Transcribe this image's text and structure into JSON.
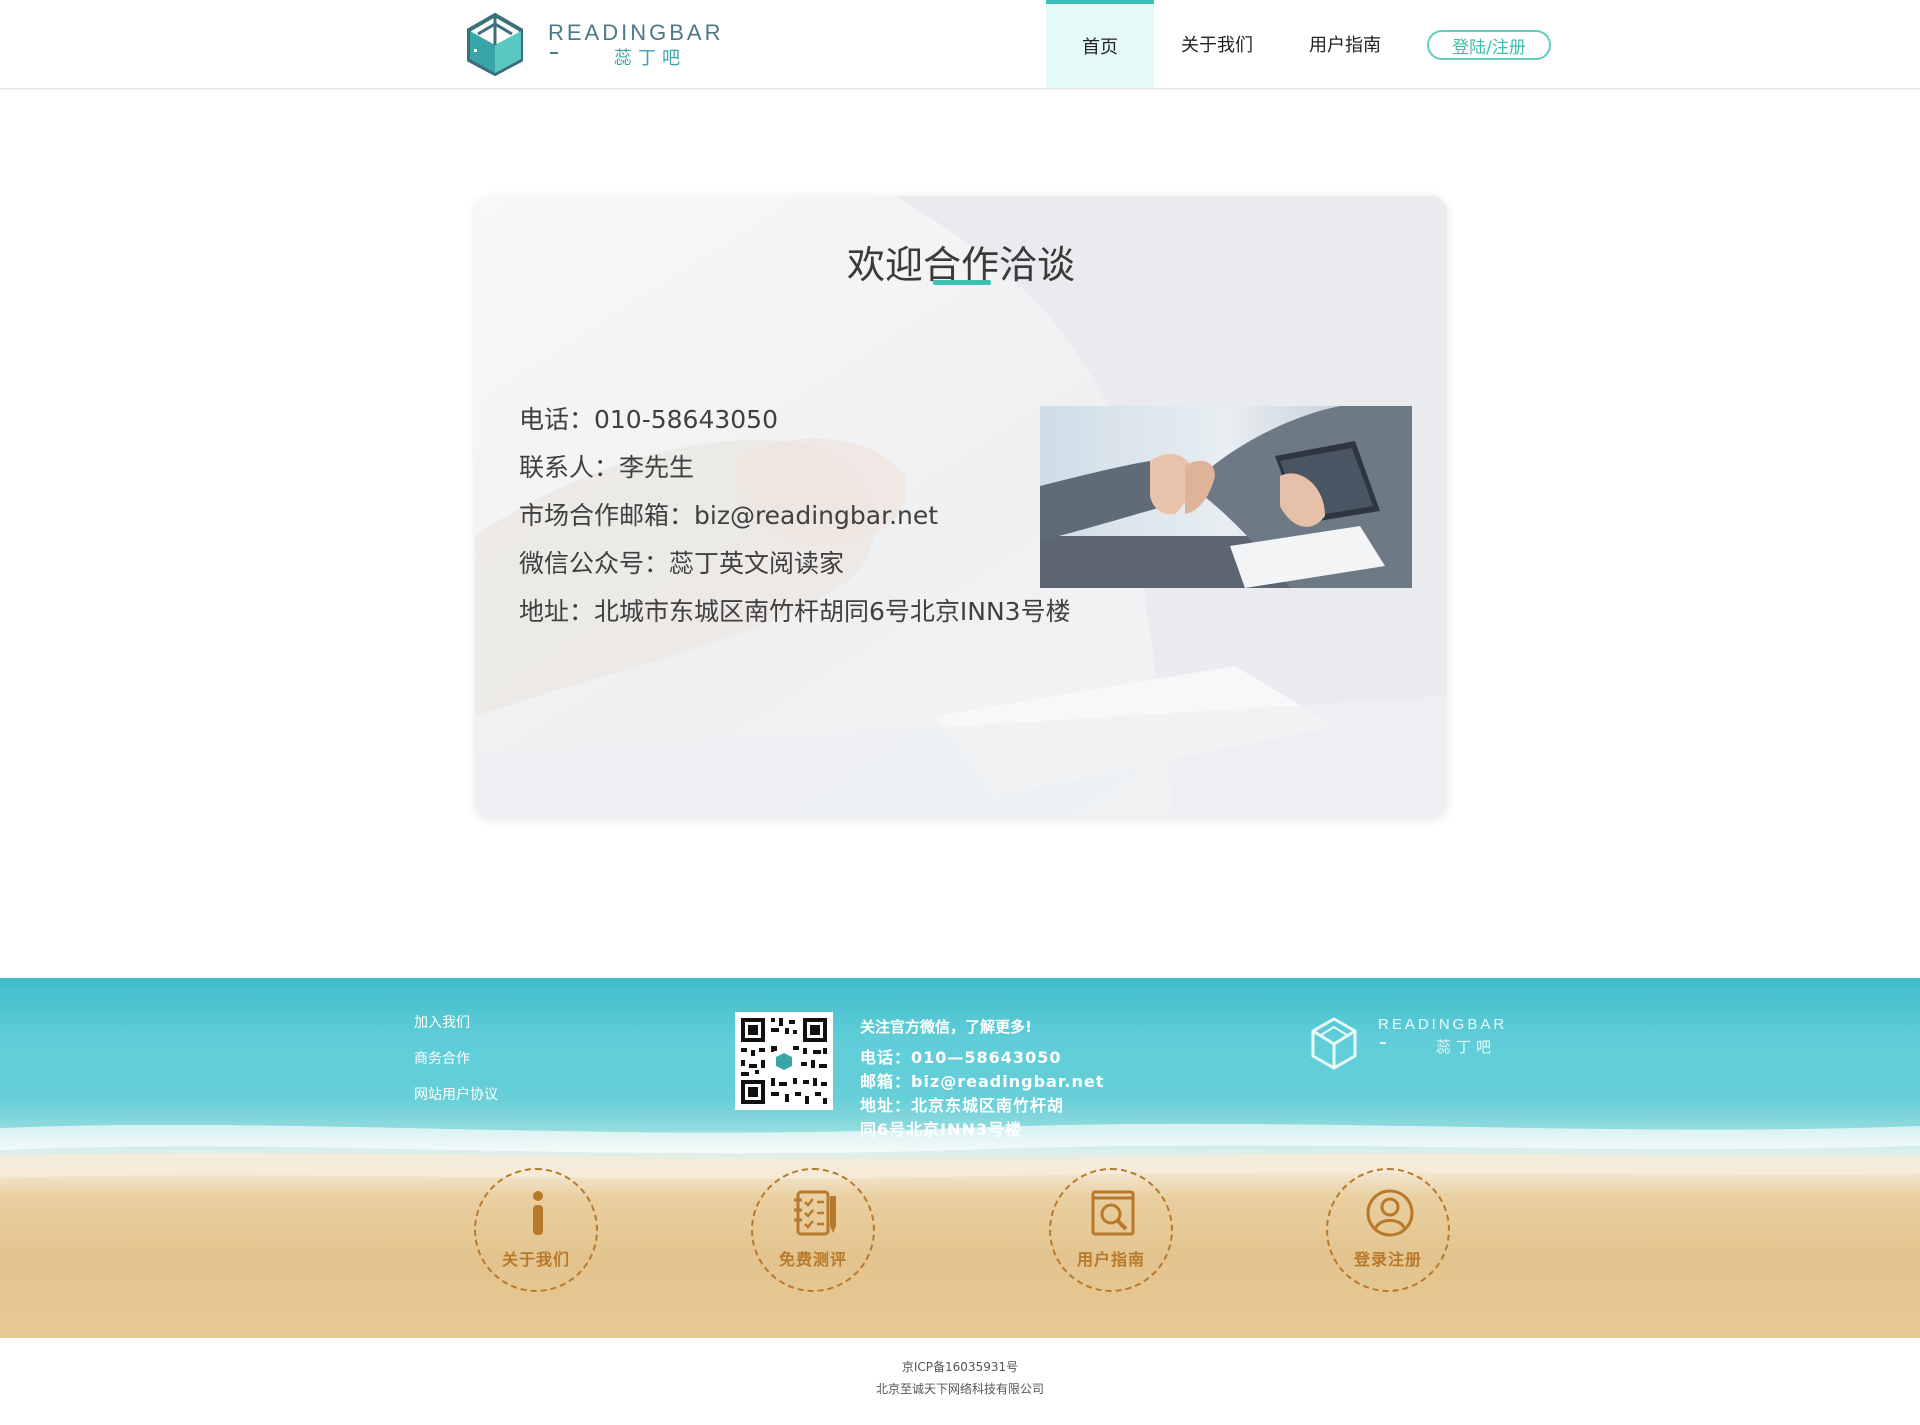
{
  "header": {
    "logo": {
      "wordmark": "READINGBAR",
      "cn": "蕊丁吧"
    },
    "nav": [
      {
        "label": "首页",
        "active": true
      },
      {
        "label": "关于我们",
        "active": false
      },
      {
        "label": "用户指南",
        "active": false
      }
    ],
    "login_label": "登陆/注册",
    "accent_color": "#39c2b5"
  },
  "main": {
    "title": "欢迎合作洽谈",
    "lines": [
      "电话：010-58643050",
      "联系人：李先生",
      "市场合作邮箱：biz@readingbar.net",
      "微信公众号：蕊丁英文阅读家",
      "地址：北城市东城区南竹杆胡同6号北京INN3号楼"
    ]
  },
  "footer": {
    "links": [
      "加入我们",
      "商务合作",
      "网站用户协议"
    ],
    "contact": {
      "title": "关注官方微信，了解更多!",
      "phone": "电话：010—58643050",
      "email": "邮箱：biz@readingbar.net",
      "address_1": "地址：北京东城区南竹杆胡",
      "address_2": "同6号北京INN3号楼"
    },
    "logo": {
      "wordmark": "READINGBAR",
      "cn": "蕊丁吧"
    },
    "shortcuts": [
      {
        "label": "关于我们",
        "icon": "info-icon"
      },
      {
        "label": "免费测评",
        "icon": "checklist-icon"
      },
      {
        "label": "用户指南",
        "icon": "book-search-icon"
      },
      {
        "label": "登录注册",
        "icon": "user-icon"
      }
    ],
    "icon_color": "#b8792b"
  },
  "bottom": {
    "icp": "京ICP备16035931号",
    "company": "北京至诚天下网络科技有限公司"
  }
}
